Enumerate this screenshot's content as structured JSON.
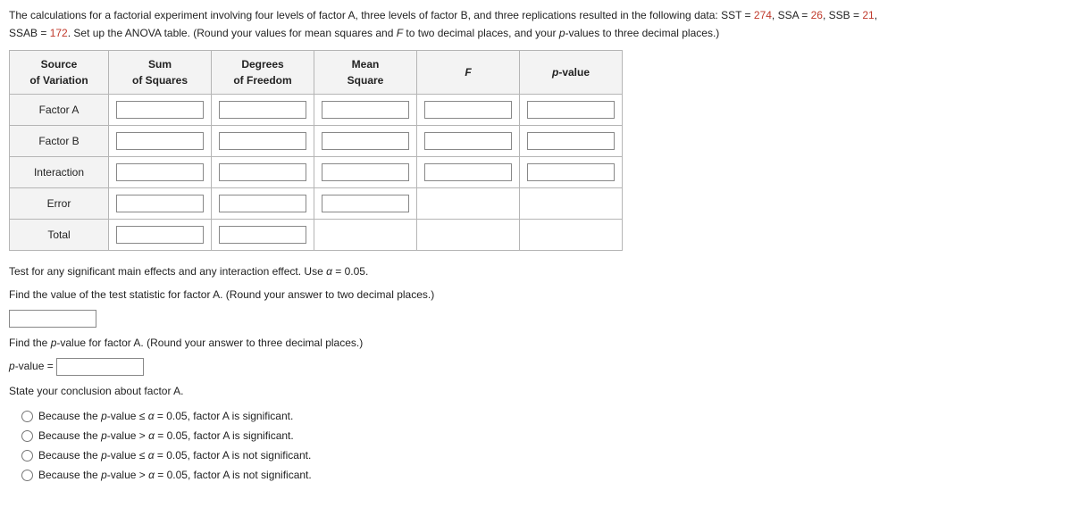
{
  "prompt": {
    "line1a": "The calculations for a factorial experiment involving four levels of factor A, three levels of factor B, and three replications resulted in the following data: SST = ",
    "sst": "274",
    "line1b": ", SSA = ",
    "ssa": "26",
    "line1c": ", SSB = ",
    "ssb": "21",
    "line1d": ",",
    "line2a": "SSAB = ",
    "ssab": "172",
    "line2b": ". Set up the ANOVA table. (Round your values for mean squares and ",
    "f_it": "F",
    "line2c": " to two decimal places, and your ",
    "p_it": "p",
    "line2d": "-values to three decimal places.)"
  },
  "anova": {
    "headers": {
      "source_l1": "Source",
      "source_l2": "of Variation",
      "ss_l1": "Sum",
      "ss_l2": "of Squares",
      "df_l1": "Degrees",
      "df_l2": "of Freedom",
      "ms_l1": "Mean",
      "ms_l2": "Square",
      "f": "F",
      "p_it": "p",
      "p_rest": "-value"
    },
    "rows": {
      "factorA": "Factor A",
      "factorB": "Factor B",
      "interaction": "Interaction",
      "error": "Error",
      "total": "Total"
    }
  },
  "q_test_intro_a": "Test for any significant main effects and any interaction effect. Use ",
  "alpha_sym": "α",
  "q_test_intro_b": " = 0.05.",
  "q_fA_stat": "Find the value of the test statistic for factor A. (Round your answer to two decimal places.)",
  "q_fA_p_a": "Find the ",
  "q_fA_p_b": "-value for factor A. (Round your answer to three decimal places.)",
  "p_eq_label_a": "p",
  "p_eq_label_b": "-value = ",
  "conclusion_intro": "State your conclusion about factor A.",
  "options": {
    "o1a": "Because the ",
    "o1b": "-value ≤ ",
    "o1c": " = 0.05, factor A is significant.",
    "o2a": "Because the ",
    "o2b": "-value > ",
    "o2c": " = 0.05, factor A is significant.",
    "o3a": "Because the ",
    "o3b": "-value ≤ ",
    "o3c": " = 0.05, factor A is not significant.",
    "o4a": "Because the ",
    "o4b": "-value > ",
    "o4c": " = 0.05, factor A is not significant."
  }
}
